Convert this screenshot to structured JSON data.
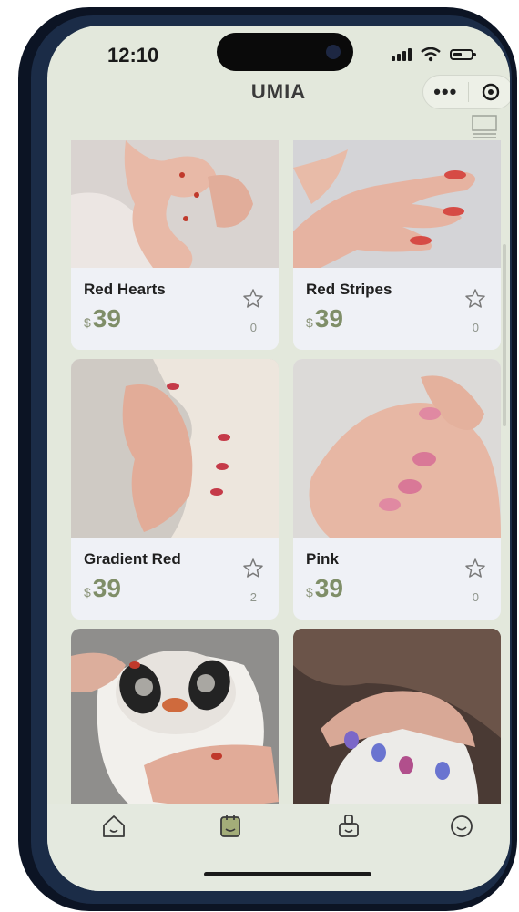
{
  "status_bar": {
    "time": "12:10"
  },
  "header": {
    "title": "UMIA",
    "more_label": "•••"
  },
  "products": [
    {
      "name": "Red Hearts",
      "currency": "$",
      "price": "39",
      "favorites": "0"
    },
    {
      "name": "Red Stripes",
      "currency": "$",
      "price": "39",
      "favorites": "0"
    },
    {
      "name": "Gradient Red",
      "currency": "$",
      "price": "39",
      "favorites": "2"
    },
    {
      "name": "Pink",
      "currency": "$",
      "price": "39",
      "favorites": "0"
    },
    {
      "name": "",
      "currency": "",
      "price": "",
      "favorites": ""
    },
    {
      "name": "",
      "currency": "",
      "price": "",
      "favorites": ""
    }
  ],
  "tabbar": {
    "items": [
      "home-icon",
      "gallery-icon",
      "mascot-icon",
      "profile-smile-icon"
    ]
  },
  "colors": {
    "accent": "#7f8e68",
    "background": "#e3e8dc",
    "card": "#eff1f6"
  }
}
